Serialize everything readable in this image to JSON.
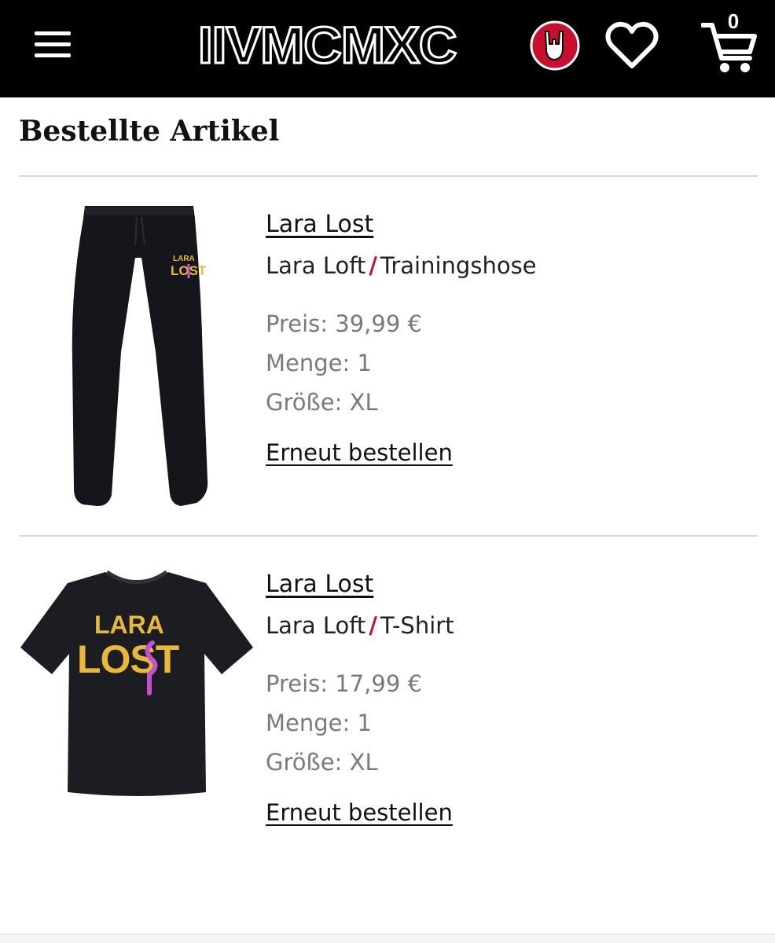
{
  "header": {
    "logo_text": "IIVMCMXC",
    "cart_count": "0",
    "icons": [
      "menu-icon",
      "horns-hand-icon",
      "heart-icon",
      "cart-icon"
    ],
    "colors": {
      "bar": "#000000",
      "logo_badge": "#c8102e"
    }
  },
  "section": {
    "title": "Bestellte Artikel"
  },
  "items": [
    {
      "name": "Lara Lost",
      "brand": "Lara Loft",
      "category": "Trainingshose",
      "price": "Preis: 39,99 €",
      "quantity": "Menge: 1",
      "size": "Größe: XL",
      "reorder_label": "Erneut bestellen",
      "print_top": "LARA",
      "print_bottom": "LOST"
    },
    {
      "name": "Lara Lost",
      "brand": "Lara Loft",
      "category": "T-Shirt",
      "price": "Preis: 17,99 €",
      "quantity": "Menge: 1",
      "size": "Größe: XL",
      "reorder_label": "Erneut bestellen",
      "print_top": "LARA",
      "print_bottom": "LOST"
    }
  ],
  "colors": {
    "accent_slash": "#c8102e",
    "print_yellow": "#e8b83a",
    "print_pink": "#c44fd0"
  }
}
